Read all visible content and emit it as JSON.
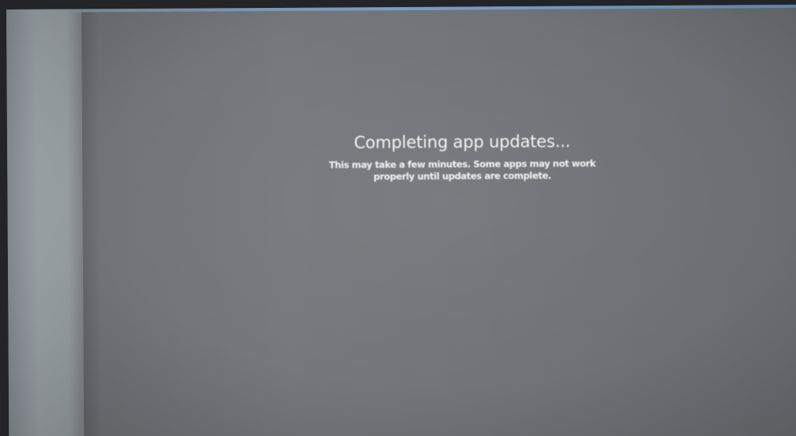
{
  "update_screen": {
    "title": "Completing app updates...",
    "body_line1": "This may take a few minutes. Some apps may not work",
    "body_line2": "properly until updates are complete."
  },
  "colors": {
    "screen_background": "#727579",
    "text": "#f3f4f5"
  }
}
